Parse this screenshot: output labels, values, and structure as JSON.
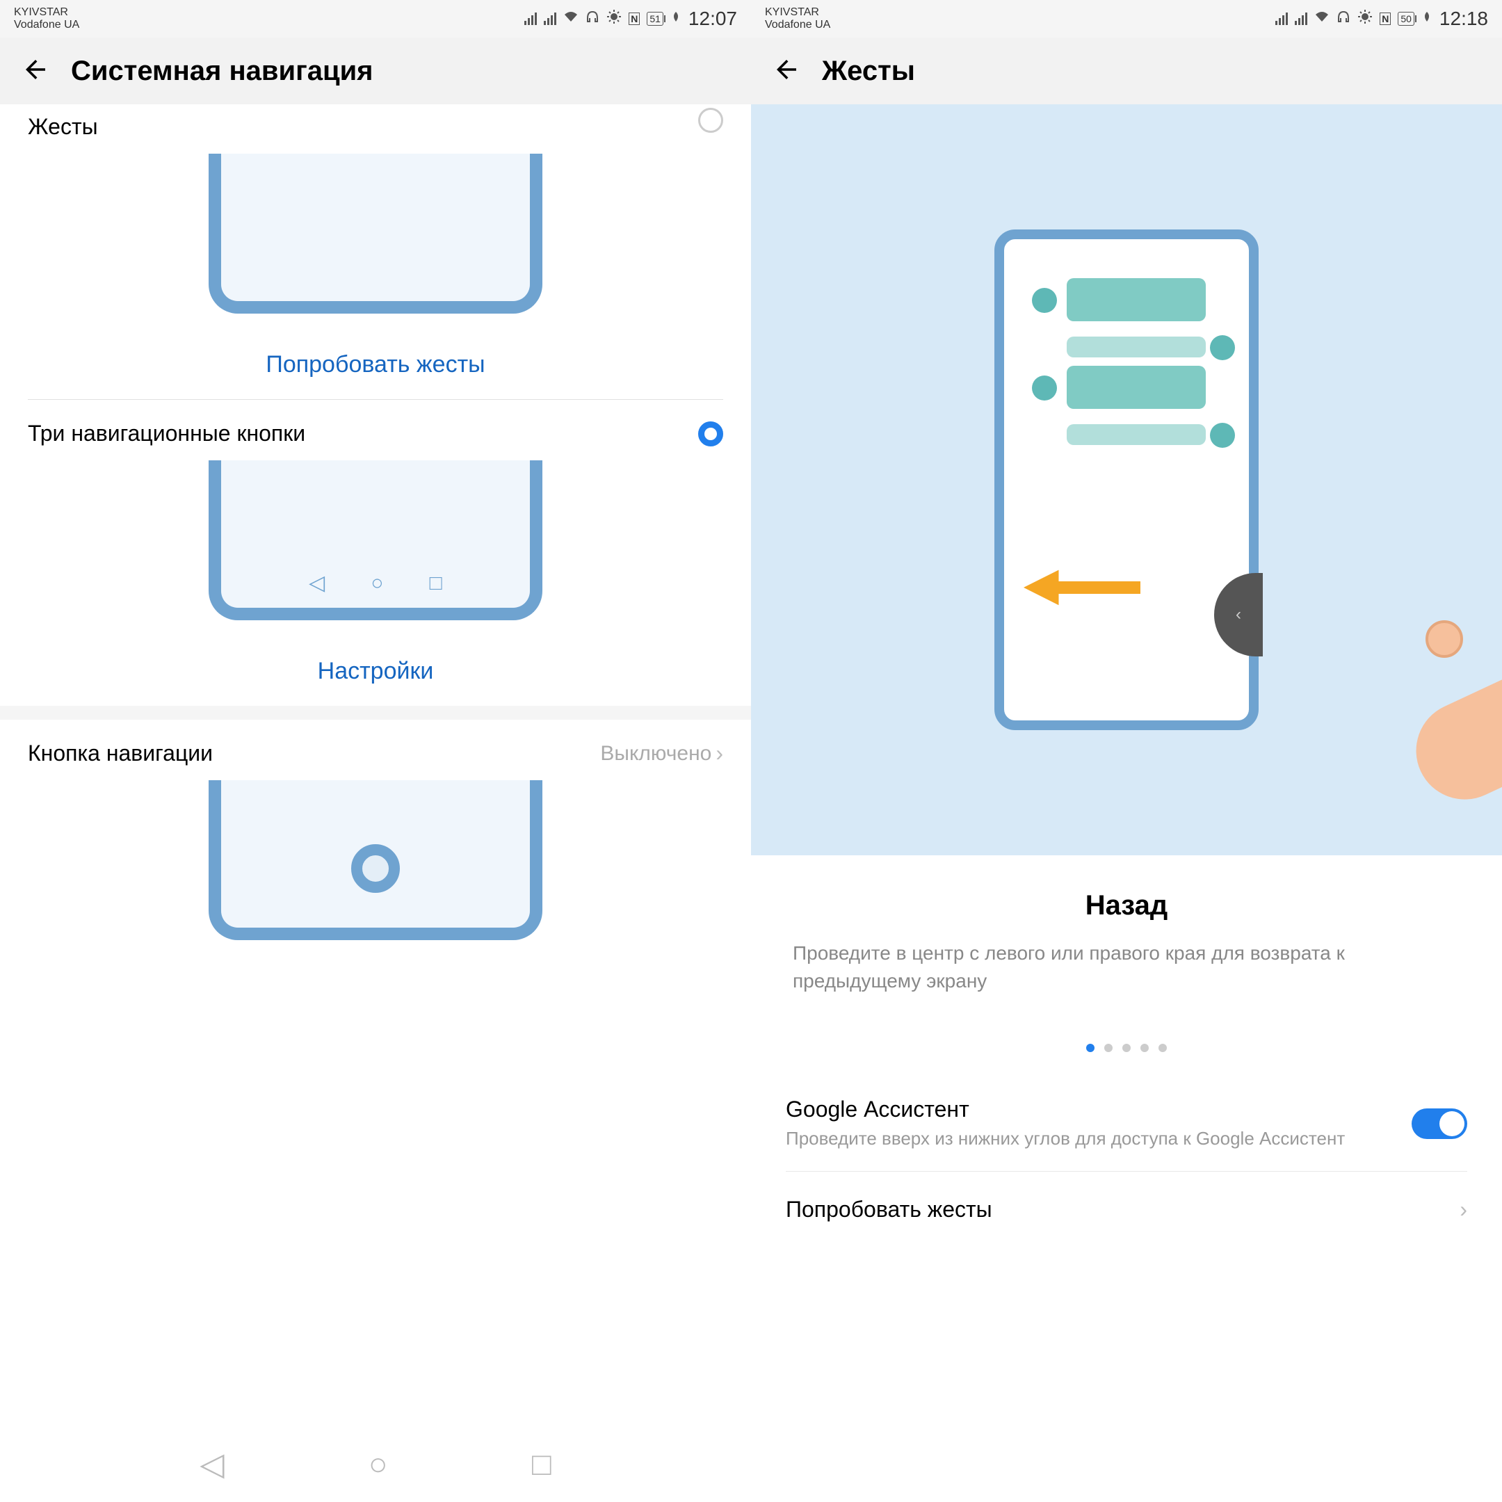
{
  "left": {
    "status": {
      "carrier1": "KYIVSTAR",
      "carrier2": "Vodafone UA",
      "battery": "51",
      "time": "12:07"
    },
    "header": {
      "title": "Системная навигация"
    },
    "gestures": {
      "label": "Жесты",
      "try": "Попробовать жесты"
    },
    "three_buttons": {
      "label": "Три навигационные кнопки",
      "settings": "Настройки"
    },
    "nav_button": {
      "label": "Кнопка навигации",
      "status": "Выключено"
    }
  },
  "right": {
    "status": {
      "carrier1": "KYIVSTAR",
      "carrier2": "Vodafone UA",
      "battery": "50",
      "time": "12:18"
    },
    "header": {
      "title": "Жесты"
    },
    "info": {
      "title": "Назад",
      "desc": "Проведите в центр с левого или правого края для возврата к предыдущему экрану"
    },
    "assistant": {
      "title": "Google Ассистент",
      "desc": "Проведите вверх из нижних углов для доступа к Google Ассистент"
    },
    "try": {
      "label": "Попробовать жесты"
    }
  }
}
